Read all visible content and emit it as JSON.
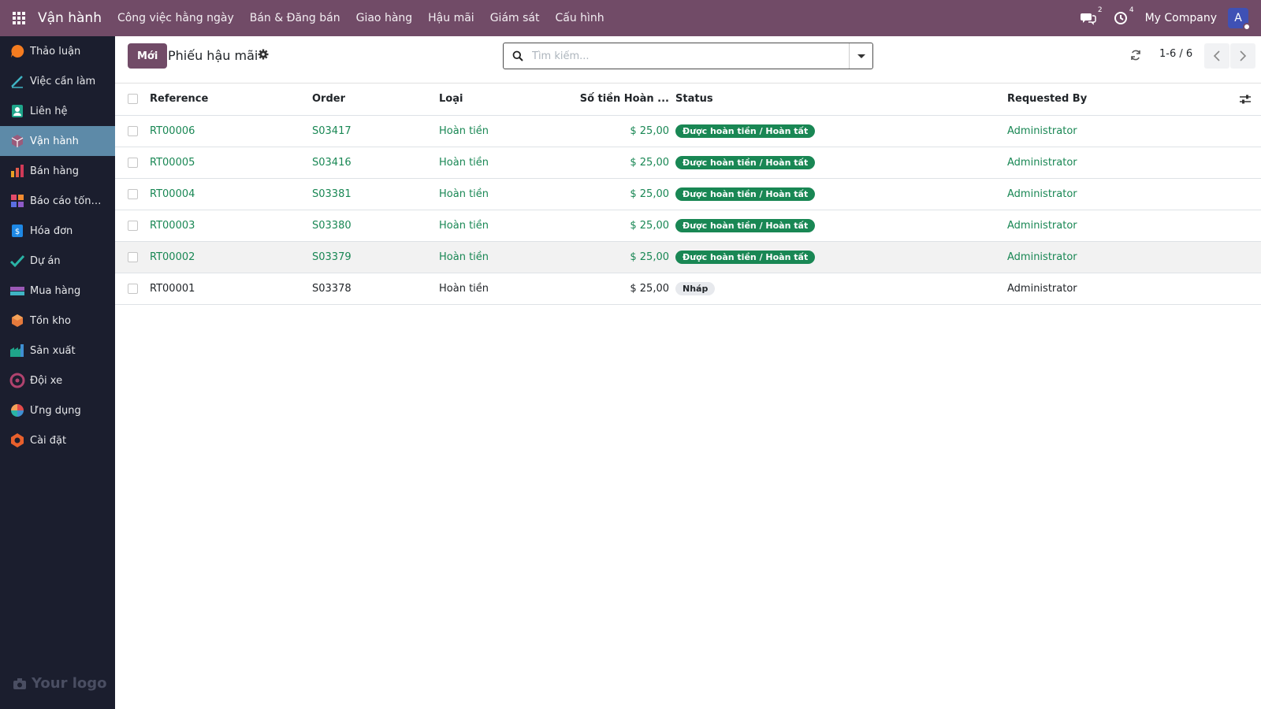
{
  "navbar": {
    "app_name": "Vận hành",
    "menu": [
      "Công việc hằng ngày",
      "Bán & Đăng bán",
      "Giao hàng",
      "Hậu mãi",
      "Giám sát",
      "Cấu hình"
    ],
    "messages_count": "2",
    "activities_count": "4",
    "company": "My Company",
    "avatar_letter": "A"
  },
  "sidebar": {
    "items": [
      {
        "label": "Thảo luận",
        "icon": "discuss-icon"
      },
      {
        "label": "Việc cần làm",
        "icon": "todo-icon"
      },
      {
        "label": "Liên hệ",
        "icon": "contacts-icon"
      },
      {
        "label": "Vận hành",
        "icon": "operations-icon",
        "active": true
      },
      {
        "label": "Bán hàng",
        "icon": "sales-icon"
      },
      {
        "label": "Báo cáo tổng ...",
        "icon": "dashboard-icon"
      },
      {
        "label": "Hóa đơn",
        "icon": "invoicing-icon"
      },
      {
        "label": "Dự án",
        "icon": "project-icon"
      },
      {
        "label": "Mua hàng",
        "icon": "purchase-icon"
      },
      {
        "label": "Tồn kho",
        "icon": "inventory-icon"
      },
      {
        "label": "Sản xuất",
        "icon": "manufacturing-icon"
      },
      {
        "label": "Đội xe",
        "icon": "fleet-icon"
      },
      {
        "label": "Ứng dụng",
        "icon": "apps-icon"
      },
      {
        "label": "Cài đặt",
        "icon": "settings-icon"
      }
    ],
    "logo_text": "Your logo"
  },
  "control": {
    "new_label": "Mới",
    "title": "Phiếu hậu mãi",
    "search_placeholder": "Tìm kiếm...",
    "pager": "1-6 / 6"
  },
  "table": {
    "headers": [
      "Reference",
      "Order",
      "Loại",
      "Số tiền Hoàn ...",
      "Status",
      "Requested By"
    ],
    "rows": [
      {
        "reference": "RT00006",
        "order": "S03417",
        "type": "Hoàn tiền",
        "amount": "$ 25,00",
        "status": "Được hoàn tiền / Hoàn tất",
        "status_kind": "success",
        "requested_by": "Administrator"
      },
      {
        "reference": "RT00005",
        "order": "S03416",
        "type": "Hoàn tiền",
        "amount": "$ 25,00",
        "status": "Được hoàn tiền / Hoàn tất",
        "status_kind": "success",
        "requested_by": "Administrator"
      },
      {
        "reference": "RT00004",
        "order": "S03381",
        "type": "Hoàn tiền",
        "amount": "$ 25,00",
        "status": "Được hoàn tiền / Hoàn tất",
        "status_kind": "success",
        "requested_by": "Administrator"
      },
      {
        "reference": "RT00003",
        "order": "S03380",
        "type": "Hoàn tiền",
        "amount": "$ 25,00",
        "status": "Được hoàn tiền / Hoàn tất",
        "status_kind": "success",
        "requested_by": "Administrator"
      },
      {
        "reference": "RT00002",
        "order": "S03379",
        "type": "Hoàn tiền",
        "amount": "$ 25,00",
        "status": "Được hoàn tiền / Hoàn tất",
        "status_kind": "success",
        "requested_by": "Administrator"
      },
      {
        "reference": "RT00001",
        "order": "S03378",
        "type": "Hoàn tiền",
        "amount": "$ 25,00",
        "status": "Nháp",
        "status_kind": "draft",
        "requested_by": "Administrator"
      }
    ]
  },
  "colors": {
    "navbar": "#714b67",
    "sidebar": "#1b1e2e",
    "sidebar_active": "#5d8aa8",
    "link_green": "#198754",
    "badge_success": "#198754"
  }
}
